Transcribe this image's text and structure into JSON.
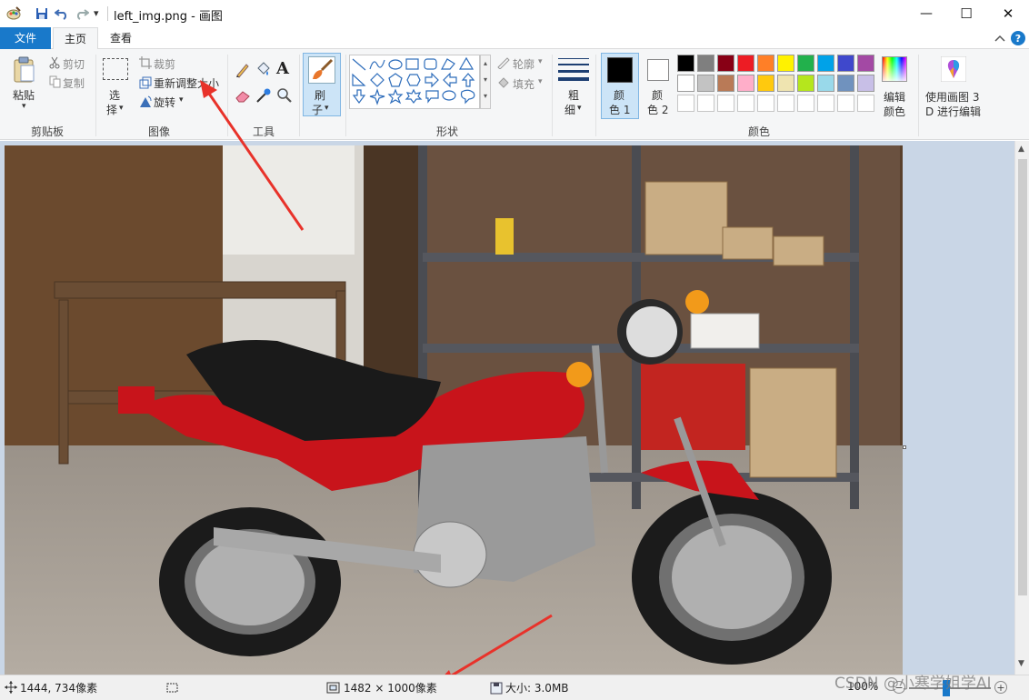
{
  "window": {
    "title": "left_img.png - 画图",
    "controls": {
      "minimize": "—",
      "maximize": "☐",
      "close": "✕"
    }
  },
  "quick_access": {
    "save_icon": "save-icon",
    "undo_icon": "undo-icon",
    "redo_icon": "redo-icon",
    "dropdown": "▾"
  },
  "tabs": [
    {
      "label": "文件",
      "active": false,
      "style": "file"
    },
    {
      "label": "主页",
      "active": true
    },
    {
      "label": "查看",
      "active": false
    }
  ],
  "ribbon": {
    "clipboard": {
      "group_label": "剪贴板",
      "paste": "粘贴",
      "cut": "剪切",
      "copy": "复制"
    },
    "image": {
      "group_label": "图像",
      "select_line1": "选",
      "select_line2": "择",
      "crop": "裁剪",
      "resize": "重新调整大小",
      "rotate": "旋转"
    },
    "tools": {
      "group_label": "工具",
      "text_tool": "A"
    },
    "brushes": {
      "line1": "刷",
      "line2": "子"
    },
    "shapes": {
      "group_label": "形状",
      "outline": "轮廓",
      "fill": "填充"
    },
    "size": {
      "line1": "粗",
      "line2": "细"
    },
    "colors": {
      "group_label": "颜色",
      "color1_line1": "颜",
      "color1_line2": "色 1",
      "color2_line1": "颜",
      "color2_line2": "色 2",
      "edit_line1": "编辑",
      "edit_line2": "颜色",
      "palette_row1": [
        "#000000",
        "#7f7f7f",
        "#880015",
        "#ed1c24",
        "#ff7f27",
        "#fff200",
        "#22b14c",
        "#00a2e8",
        "#3f48cc",
        "#a349a4"
      ],
      "palette_row2": [
        "#ffffff",
        "#c3c3c3",
        "#b97a57",
        "#ffaec9",
        "#ffc90e",
        "#efe4b0",
        "#b5e61d",
        "#99d9ea",
        "#7092be",
        "#c8bfe7"
      ]
    },
    "paint3d": {
      "line1": "使用画图 3",
      "line2": "D 进行编辑"
    }
  },
  "canvas": {
    "image_description_label": "motorcycle photo"
  },
  "statusbar": {
    "cursor_pos": "1444, 734像素",
    "dimensions": "1482 × 1000像素",
    "file_size": "大小: 3.0MB",
    "zoom": "100%",
    "watermark": "CSDN @小寒学姐学AI"
  },
  "accent": "#1979ca"
}
